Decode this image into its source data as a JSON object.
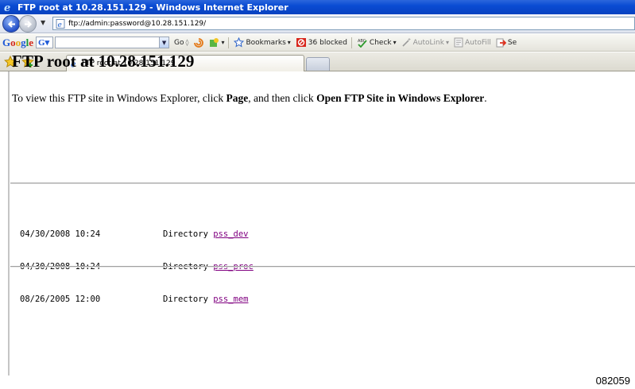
{
  "window": {
    "title": "FTP root at 10.28.151.129 - Windows Internet Explorer"
  },
  "address_bar": {
    "url": "ftp://admin:password@10.28.151.129/"
  },
  "google_toolbar": {
    "logo": "Google",
    "go_label": "Go",
    "bookmarks_label": "Bookmarks",
    "blocked_label": "36 blocked",
    "check_label": "Check",
    "autolink_label": "AutoLink",
    "autofill_label": "AutoFill",
    "send_label": "Se"
  },
  "tabs": [
    {
      "label": "FTP root at 10.28.151.129",
      "active": true
    }
  ],
  "page": {
    "heading": "FTP root at 10.28.151.129",
    "instruction_prefix": "To view this FTP site in Windows Explorer, click ",
    "instruction_page": "Page",
    "instruction_middle": ", and then click ",
    "instruction_open": "Open FTP Site in Windows Explorer",
    "instruction_end": ".",
    "listing": [
      {
        "date": "04/30/2008 10:24",
        "type": "Directory",
        "name": "pss_dev"
      },
      {
        "date": "04/30/2008 10:24",
        "type": "Directory",
        "name": "pss_proc"
      },
      {
        "date": "08/26/2005 12:00",
        "type": "Directory",
        "name": "pss_mem"
      }
    ]
  },
  "figure_id": "082059",
  "colors": {
    "titlebar": "#0a4bd3",
    "visited_link": "#800080"
  }
}
